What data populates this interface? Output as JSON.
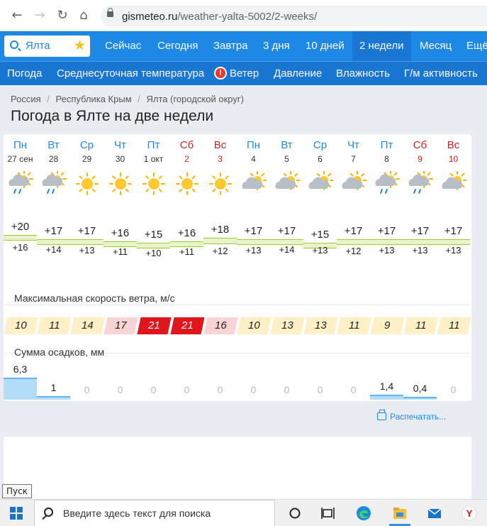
{
  "browser": {
    "url_host": "gismeteo.ru",
    "url_path": "/weather-yalta-5002/2-weeks/",
    "back_icon": "arrow-left-icon",
    "forward_icon": "arrow-right-icon",
    "reload_icon": "reload-icon",
    "home_icon": "home-icon"
  },
  "header": {
    "city": "Ялта",
    "tabs": [
      "Сейчас",
      "Сегодня",
      "Завтра",
      "3 дня",
      "10 дней",
      "2 недели",
      "Месяц",
      "Ещё"
    ],
    "active_tab": "2 недели",
    "sub_tabs": [
      "Погода",
      "Среднесуточная температура",
      "Ветер",
      "Давление",
      "Влажность",
      "Г/м активность"
    ],
    "warning_mark": "!"
  },
  "breadcrumb": [
    "Россия",
    "Республика Крым",
    "Ялта (городской округ)"
  ],
  "breadcrumb_sep": "/",
  "page_title": "Погода в Ялте на две недели",
  "days": [
    {
      "dow": "Пн",
      "date": "27 сен",
      "icon": "cloud-rain-sun",
      "tmax": "+20",
      "tmin": "+16",
      "wind": "10",
      "precip": "6,3"
    },
    {
      "dow": "Вт",
      "date": "28",
      "icon": "cloud-rain-sun",
      "tmax": "+17",
      "tmin": "+14",
      "wind": "11",
      "precip": "1"
    },
    {
      "dow": "Ср",
      "date": "29",
      "icon": "sun",
      "tmax": "+17",
      "tmin": "+13",
      "wind": "14",
      "precip": "0"
    },
    {
      "dow": "Чт",
      "date": "30",
      "icon": "sun",
      "tmax": "+16",
      "tmin": "+11",
      "wind": "17",
      "precip": "0"
    },
    {
      "dow": "Пт",
      "date": "1 окт",
      "icon": "sun",
      "tmax": "+15",
      "tmin": "+10",
      "wind": "21",
      "precip": "0"
    },
    {
      "dow": "Сб",
      "date": "2",
      "icon": "sun",
      "tmax": "+16",
      "tmin": "+11",
      "wind": "21",
      "precip": "0"
    },
    {
      "dow": "Вс",
      "date": "3",
      "icon": "sun",
      "tmax": "+18",
      "tmin": "+12",
      "wind": "16",
      "precip": "0"
    },
    {
      "dow": "Пн",
      "date": "4",
      "icon": "cloud-sun",
      "tmax": "+17",
      "tmin": "+13",
      "wind": "10",
      "precip": "0"
    },
    {
      "dow": "Вт",
      "date": "5",
      "icon": "cloud-sun",
      "tmax": "+17",
      "tmin": "+14",
      "wind": "13",
      "precip": "0"
    },
    {
      "dow": "Ср",
      "date": "6",
      "icon": "cloud-sun",
      "tmax": "+15",
      "tmin": "+13",
      "wind": "13",
      "precip": "0"
    },
    {
      "dow": "Чт",
      "date": "7",
      "icon": "cloud-sun",
      "tmax": "+17",
      "tmin": "+12",
      "wind": "11",
      "precip": "0"
    },
    {
      "dow": "Пт",
      "date": "8",
      "icon": "cloud-rain-sun",
      "tmax": "+17",
      "tmin": "+13",
      "wind": "9",
      "precip": "1,4"
    },
    {
      "dow": "Сб",
      "date": "9",
      "icon": "cloud-rain-sun",
      "tmax": "+17",
      "tmin": "+13",
      "wind": "11",
      "precip": "0,4"
    },
    {
      "dow": "Вс",
      "date": "10",
      "icon": "cloud-sun",
      "tmax": "+17",
      "tmin": "+13",
      "wind": "11",
      "precip": "0"
    }
  ],
  "wind_label": "Максимальная скорость ветра, м/с",
  "precip_label": "Сумма осадков, мм",
  "print_label": "Распечатать...",
  "tooltip": "Пуск",
  "taskbar": {
    "search_placeholder": "Введите здесь текст для поиска",
    "icons": [
      "cortana-circle-icon",
      "task-view-icon",
      "edge-icon",
      "file-explorer-icon",
      "mail-icon",
      "yandex-browser-icon"
    ]
  },
  "colors": {
    "brand_blue": "#1e88e5",
    "weekend_red": "#c62828",
    "temp_band": "#e8f3c9",
    "wind_low": "#fdf0c6",
    "wind_mid": "#f9d4d4",
    "wind_high": "#e0161c"
  }
}
